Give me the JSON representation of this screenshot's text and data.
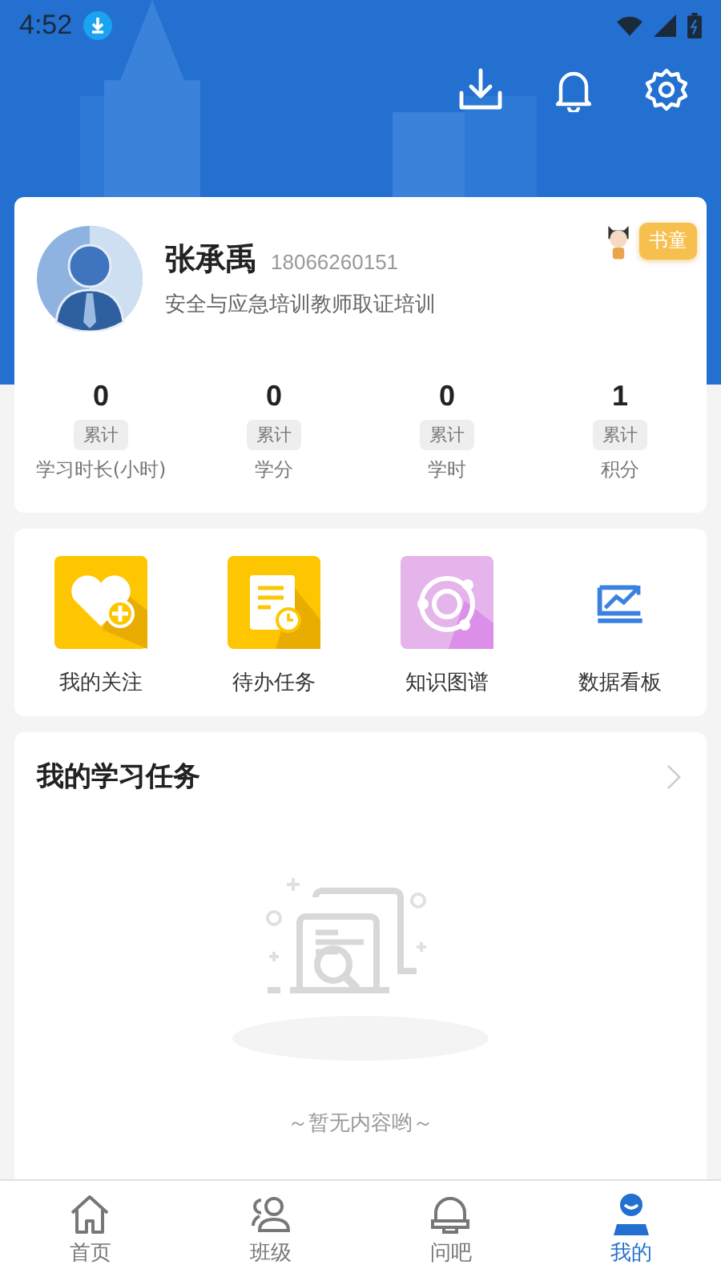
{
  "status_bar": {
    "time": "4:52"
  },
  "profile": {
    "name": "张承禹",
    "phone": "18066260151",
    "course": "安全与应急培训教师取证培训",
    "badge": "书童"
  },
  "stats": [
    {
      "value": "0",
      "tag": "累计",
      "label": "学习时长(小时)"
    },
    {
      "value": "0",
      "tag": "累计",
      "label": "学分"
    },
    {
      "value": "0",
      "tag": "累计",
      "label": "学时"
    },
    {
      "value": "1",
      "tag": "累计",
      "label": "积分"
    }
  ],
  "features": [
    {
      "kind": "heart",
      "label": "我的关注"
    },
    {
      "kind": "task",
      "label": "待办任务"
    },
    {
      "kind": "graph",
      "label": "知识图谱"
    },
    {
      "kind": "chart",
      "label": "数据看板"
    }
  ],
  "tasks": {
    "title": "我的学习任务",
    "empty_text": "～暂无内容哟～"
  },
  "nav": [
    {
      "kind": "home",
      "label": "首页",
      "selected": false
    },
    {
      "kind": "class",
      "label": "班级",
      "selected": false
    },
    {
      "kind": "ask",
      "label": "问吧",
      "selected": false
    },
    {
      "kind": "me",
      "label": "我的",
      "selected": true
    }
  ]
}
